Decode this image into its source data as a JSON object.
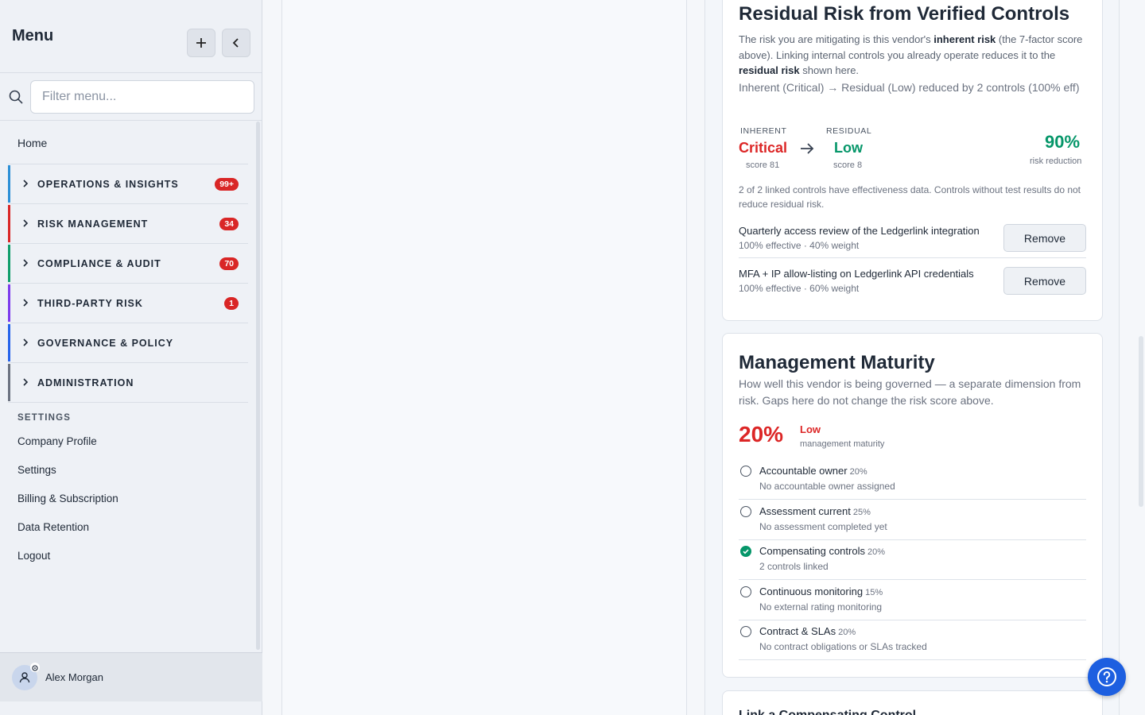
{
  "sidebar": {
    "title": "Menu",
    "filter_placeholder": "Filter menu...",
    "home": "Home",
    "groups": [
      {
        "label": "OPERATIONS & INSIGHTS",
        "badge": "99+",
        "color": "#2b8fd6"
      },
      {
        "label": "RISK MANAGEMENT",
        "badge": "34",
        "color": "#d92626"
      },
      {
        "label": "COMPLIANCE & AUDIT",
        "badge": "70",
        "color": "#0f9d6b"
      },
      {
        "label": "THIRD-PARTY RISK",
        "badge": "1",
        "color": "#7c3aed"
      },
      {
        "label": "GOVERNANCE & POLICY",
        "badge": "",
        "color": "#2563eb"
      },
      {
        "label": "ADMINISTRATION",
        "badge": "",
        "color": "#6b7280"
      }
    ],
    "settings_heading": "SETTINGS",
    "settings_items": [
      "Company Profile",
      "Settings",
      "Billing & Subscription",
      "Data Retention",
      "Logout"
    ],
    "user_name": "Alex Morgan"
  },
  "residual": {
    "title": "Residual Risk from Verified Controls",
    "intro_1": "The risk you are mitigating is this vendor's ",
    "intro_b1": "inherent risk",
    "intro_2": " (the 7-factor score above). Linking internal controls you already operate reduces it to the ",
    "intro_b2": "residual risk",
    "intro_3": " shown here.",
    "summary": "Inherent (Critical) → Residual (Low) reduced by 2 controls (100% eff)",
    "inherent_label": "INHERENT",
    "inherent_value": "Critical",
    "inherent_score": "score 81",
    "residual_label": "RESIDUAL",
    "residual_value": "Low",
    "residual_score": "score 8",
    "reduction_pct": "90%",
    "reduction_label": "risk reduction",
    "note": "2 of 2 linked controls have effectiveness data. Controls without test results do not reduce residual risk.",
    "controls": [
      {
        "title": "Quarterly access review of the Ledgerlink integration",
        "sub": "100% effective · 40% weight",
        "button": "Remove"
      },
      {
        "title": "MFA + IP allow-listing on Ledgerlink API credentials",
        "sub": "100% effective · 60% weight",
        "button": "Remove"
      }
    ]
  },
  "maturity": {
    "title": "Management Maturity",
    "description": "How well this vendor is being governed — a separate dimension from risk. Gaps here do not change the risk score above.",
    "pct": "20%",
    "level": "Low",
    "level_sub": "management maturity",
    "items": [
      {
        "title": "Accountable owner",
        "weight": "20%",
        "sub": "No accountable owner assigned",
        "done": false
      },
      {
        "title": "Assessment current",
        "weight": "25%",
        "sub": "No assessment completed yet",
        "done": false
      },
      {
        "title": "Compensating controls",
        "weight": "20%",
        "sub": "2 controls linked",
        "done": true
      },
      {
        "title": "Continuous monitoring",
        "weight": "15%",
        "sub": "No external rating monitoring",
        "done": false
      },
      {
        "title": "Contract & SLAs",
        "weight": "20%",
        "sub": "No contract obligations or SLAs tracked",
        "done": false
      }
    ]
  },
  "next_card_title": "Link a Compensating Control",
  "colors": {
    "accent": "#1d5fe0",
    "critical": "#dc2626",
    "success": "#059669"
  }
}
